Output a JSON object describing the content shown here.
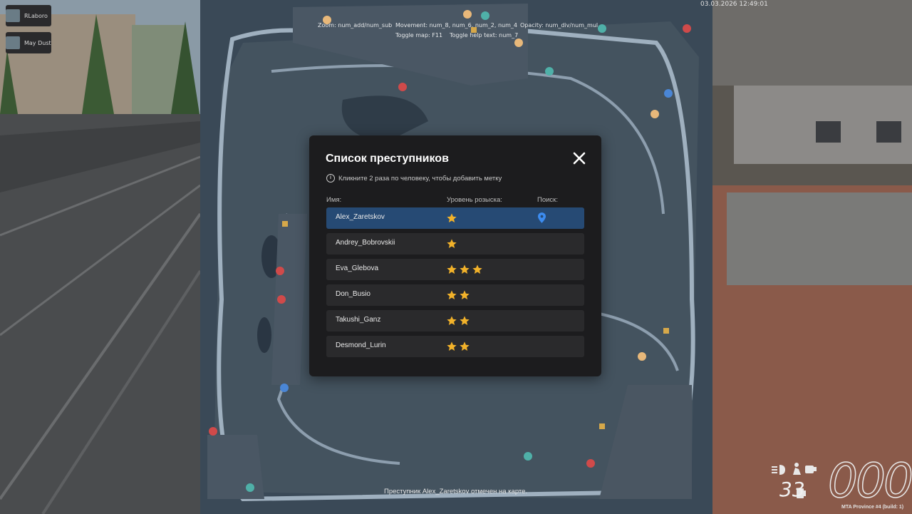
{
  "hud": {
    "datetime": "03.03.2026 12:49:01",
    "players": [
      "RLaboro",
      "May Dust"
    ]
  },
  "map_help": {
    "zoom": "Zoom: num_add/num_sub",
    "movement": "Movement: num_8, num_6, num_2, num_4",
    "opacity": "Opacity: num_div/num_mul",
    "toggle_map": "Toggle map: F11",
    "toggle_help": "Toggle help text: num_7"
  },
  "modal": {
    "title": "Список преступников",
    "hint": "Кликните 2 раза по человеку, чтобы добавить метку",
    "columns": {
      "name": "Имя:",
      "wanted": "Уровень розыска:",
      "search": "Поиск:"
    },
    "rows": [
      {
        "name": "Alex_Zaretskov",
        "stars": 1,
        "selected": true
      },
      {
        "name": "Andrey_Bobrovskii",
        "stars": 1,
        "selected": false
      },
      {
        "name": "Eva_Glebova",
        "stars": 3,
        "selected": false
      },
      {
        "name": "Don_Busio",
        "stars": 2,
        "selected": false
      },
      {
        "name": "Takushi_Ganz",
        "stars": 2,
        "selected": false
      },
      {
        "name": "Desmond_Lurin",
        "stars": 2,
        "selected": false
      }
    ],
    "colors": {
      "star": "#f2b22a",
      "selected_row": "#264a74",
      "pin": "#3c8cf0"
    }
  },
  "notification": "Преступник Alex_Zaretskov отмечен на карте.",
  "server": "MTA Province #4 (build: 1)",
  "speedometer": {
    "speed": "33",
    "gear": "000"
  }
}
